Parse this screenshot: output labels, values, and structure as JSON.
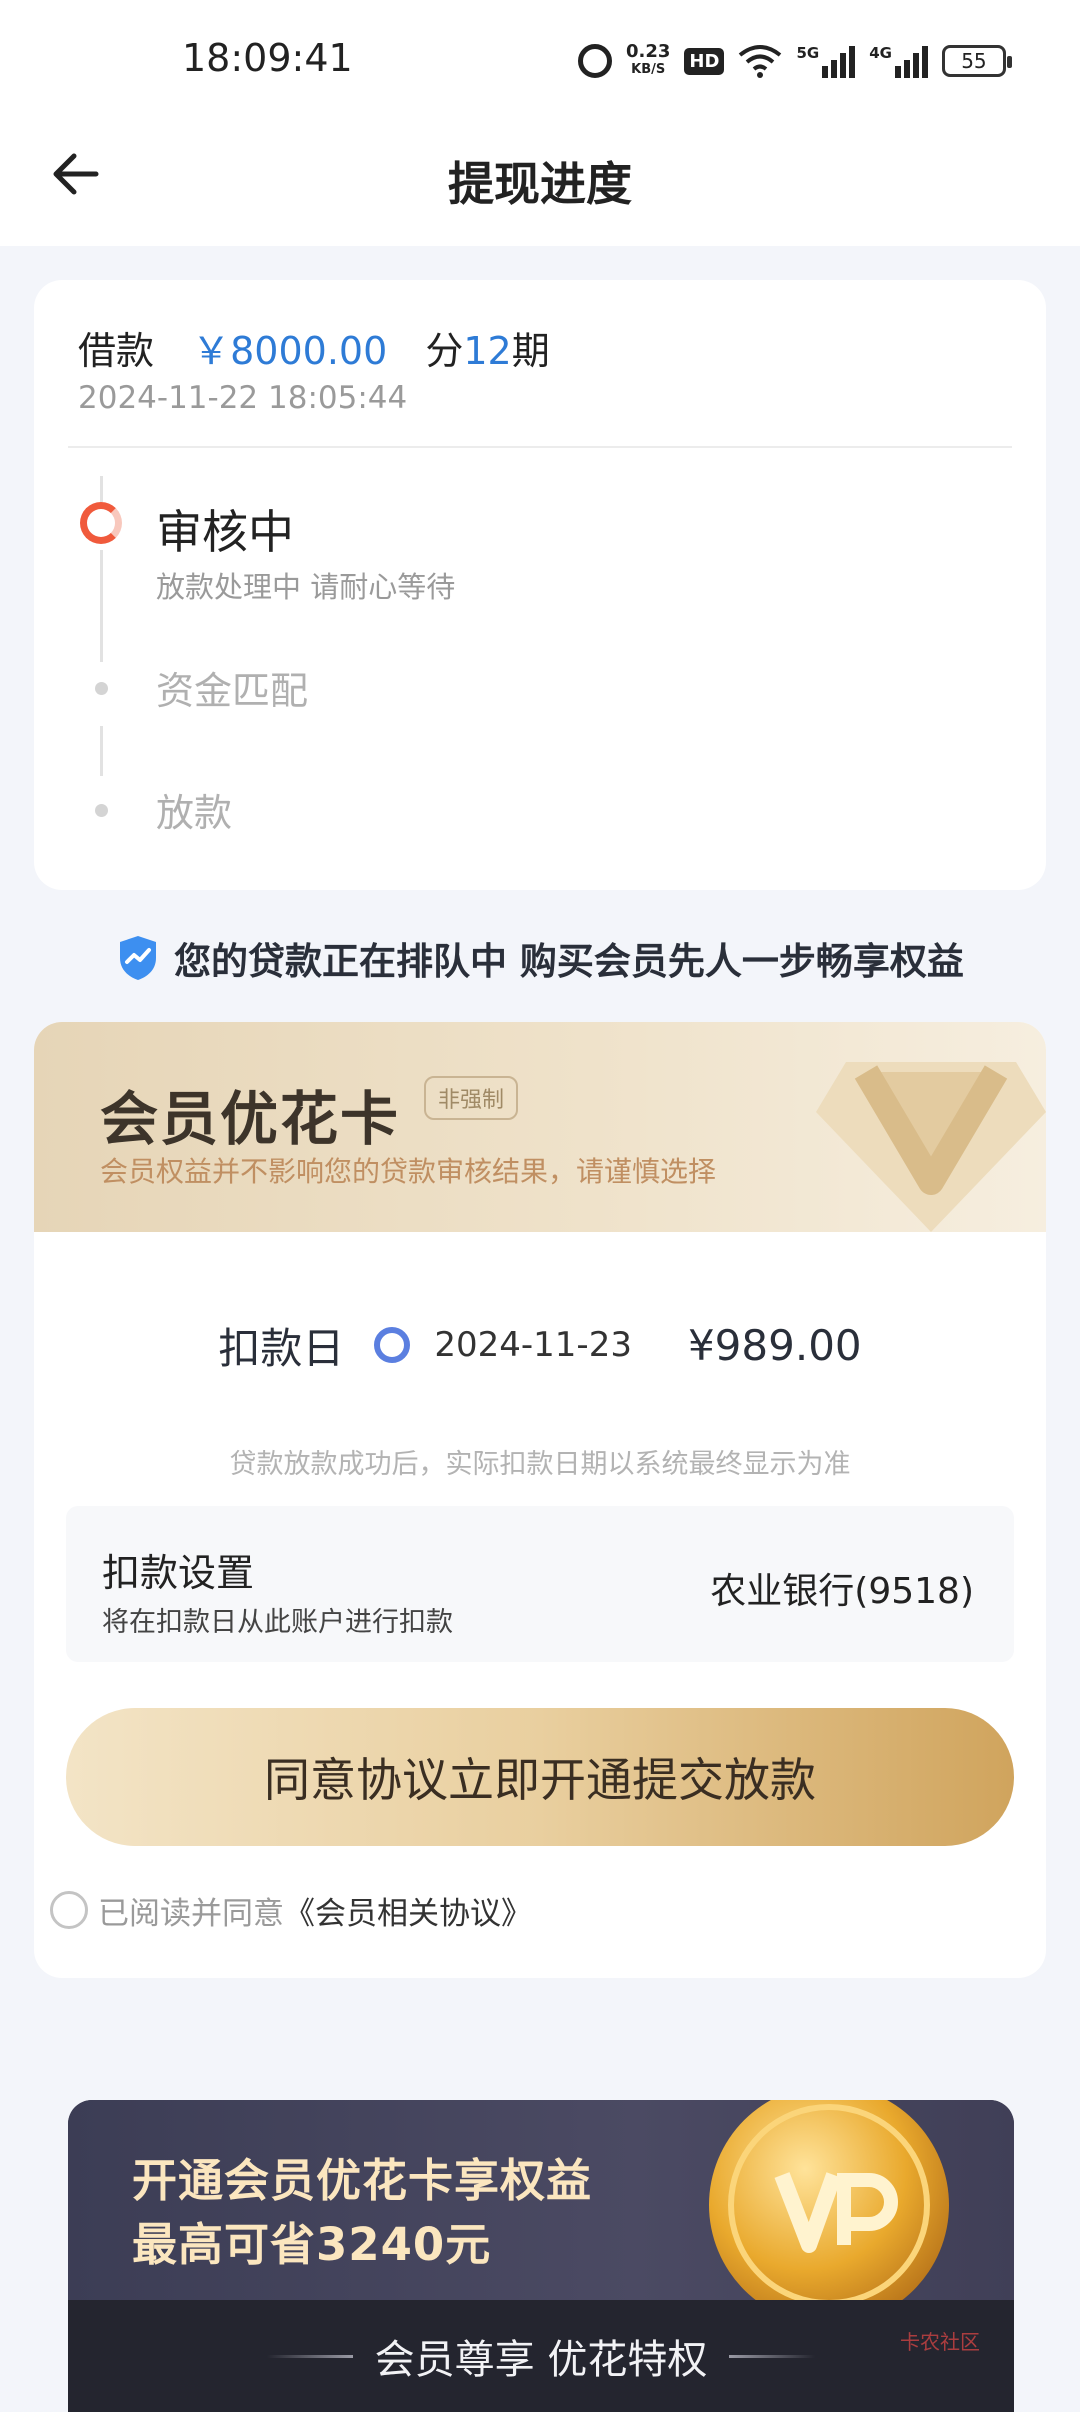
{
  "status_bar": {
    "time": "18:09:41",
    "speed_value": "0.23",
    "speed_unit": "KB/S",
    "hd": "HD",
    "net1": "5G",
    "net2": "4G",
    "battery": "55"
  },
  "header": {
    "title": "提现进度"
  },
  "loan": {
    "label": "借款",
    "amount": "￥8000.00",
    "term_prefix": "分",
    "term_count": "12",
    "term_suffix": "期",
    "time": "2024-11-22 18:05:44"
  },
  "steps": [
    {
      "title": "审核中",
      "subtitle": "放款处理中 请耐心等待",
      "status": "current"
    },
    {
      "title": "资金匹配",
      "status": "pending"
    },
    {
      "title": "放款",
      "status": "pending"
    }
  ],
  "notice": {
    "text": "您的贷款正在排队中 购买会员先人一步畅享权益"
  },
  "member": {
    "title": "会员优花卡",
    "tag": "非强制",
    "subtitle": "会员权益并不影响您的贷款审核结果，请谨慎选择",
    "deduct_label": "扣款日",
    "deduct_date": "2024-11-23",
    "deduct_amount": "¥989.00",
    "deduct_note": "贷款放款成功后，实际扣款日期以系统最终显示为准",
    "setting_title": "扣款设置",
    "setting_sub": "将在扣款日从此账户进行扣款",
    "setting_bank": "农业银行(9518)",
    "submit_label": "同意协议立即开通提交放款",
    "agree_text": "已阅读并同意",
    "agree_link": "《会员相关协议》"
  },
  "promo": {
    "line1": "开通会员优花卡享权益",
    "line2": "最高可省3240元",
    "footer": "会员尊享 优花特权",
    "watermark": "卡农社区"
  },
  "colors": {
    "accent_blue": "#2e7bd6",
    "status_orange": "#f05a3c",
    "gold": "#d0a45d"
  }
}
